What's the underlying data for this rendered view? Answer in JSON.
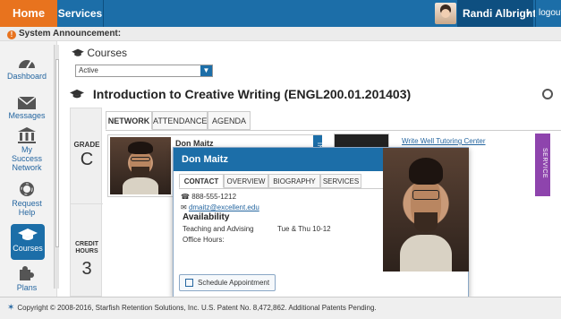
{
  "topbar": {
    "home_label": "Home",
    "services_label": "Services",
    "user_name": "Randi Albright",
    "user_caret": "▾",
    "logout_label": "logout"
  },
  "announcement": {
    "label": "System Announcement:"
  },
  "sidebar": {
    "items": [
      {
        "label": "Dashboard",
        "icon": "speedometer-icon"
      },
      {
        "label": "Messages",
        "icon": "envelope-icon"
      },
      {
        "label": "My Success Network",
        "icon": "institution-icon"
      },
      {
        "label": "Request Help",
        "icon": "lifebuoy-icon"
      },
      {
        "label": "Courses",
        "icon": "graduation-cap-icon",
        "active": true
      },
      {
        "label": "Plans",
        "icon": "puzzle-icon"
      }
    ]
  },
  "main": {
    "courses_header": "Courses",
    "filter_value": "Active",
    "course_title": "Introduction to Creative Writing (ENGL200.01.201403)",
    "grade_label": "GRADE",
    "grade_value": "C",
    "credit_label_1": "CREDIT",
    "credit_label_2": "HOURS",
    "credit_value": "3",
    "tabs": [
      {
        "label": "NETWORK",
        "active": true
      },
      {
        "label": "ATTENDANCE"
      },
      {
        "label": "AGENDA"
      }
    ],
    "card_name": "Don Maitz",
    "card_vtab": "INS",
    "tutor_link": "Write Well Tutoring Center",
    "service_tab": "SERVICE"
  },
  "popover": {
    "name": "Don Maitz",
    "tabs": [
      {
        "label": "CONTACT",
        "active": true
      },
      {
        "label": "OVERVIEW"
      },
      {
        "label": "BIOGRAPHY"
      },
      {
        "label": "SERVICES"
      }
    ],
    "phone": "888-555-1212",
    "email": "dmaitz@excellent.edu",
    "availability_header": "Availability",
    "availability_row_label": "Teaching and Advising",
    "availability_row_time": "Tue & Thu 10-12",
    "office_hours_label": "Office Hours:",
    "schedule_button": "Schedule Appointment"
  },
  "footer": {
    "text": "Copyright © 2008-2016, Starfish Retention Solutions, Inc. U.S. Patent No. 8,472,862. Additional Patents Pending."
  },
  "colors": {
    "brand_blue": "#1c6ea8",
    "home_orange": "#e8731e",
    "service_purple": "#8e44ad"
  }
}
